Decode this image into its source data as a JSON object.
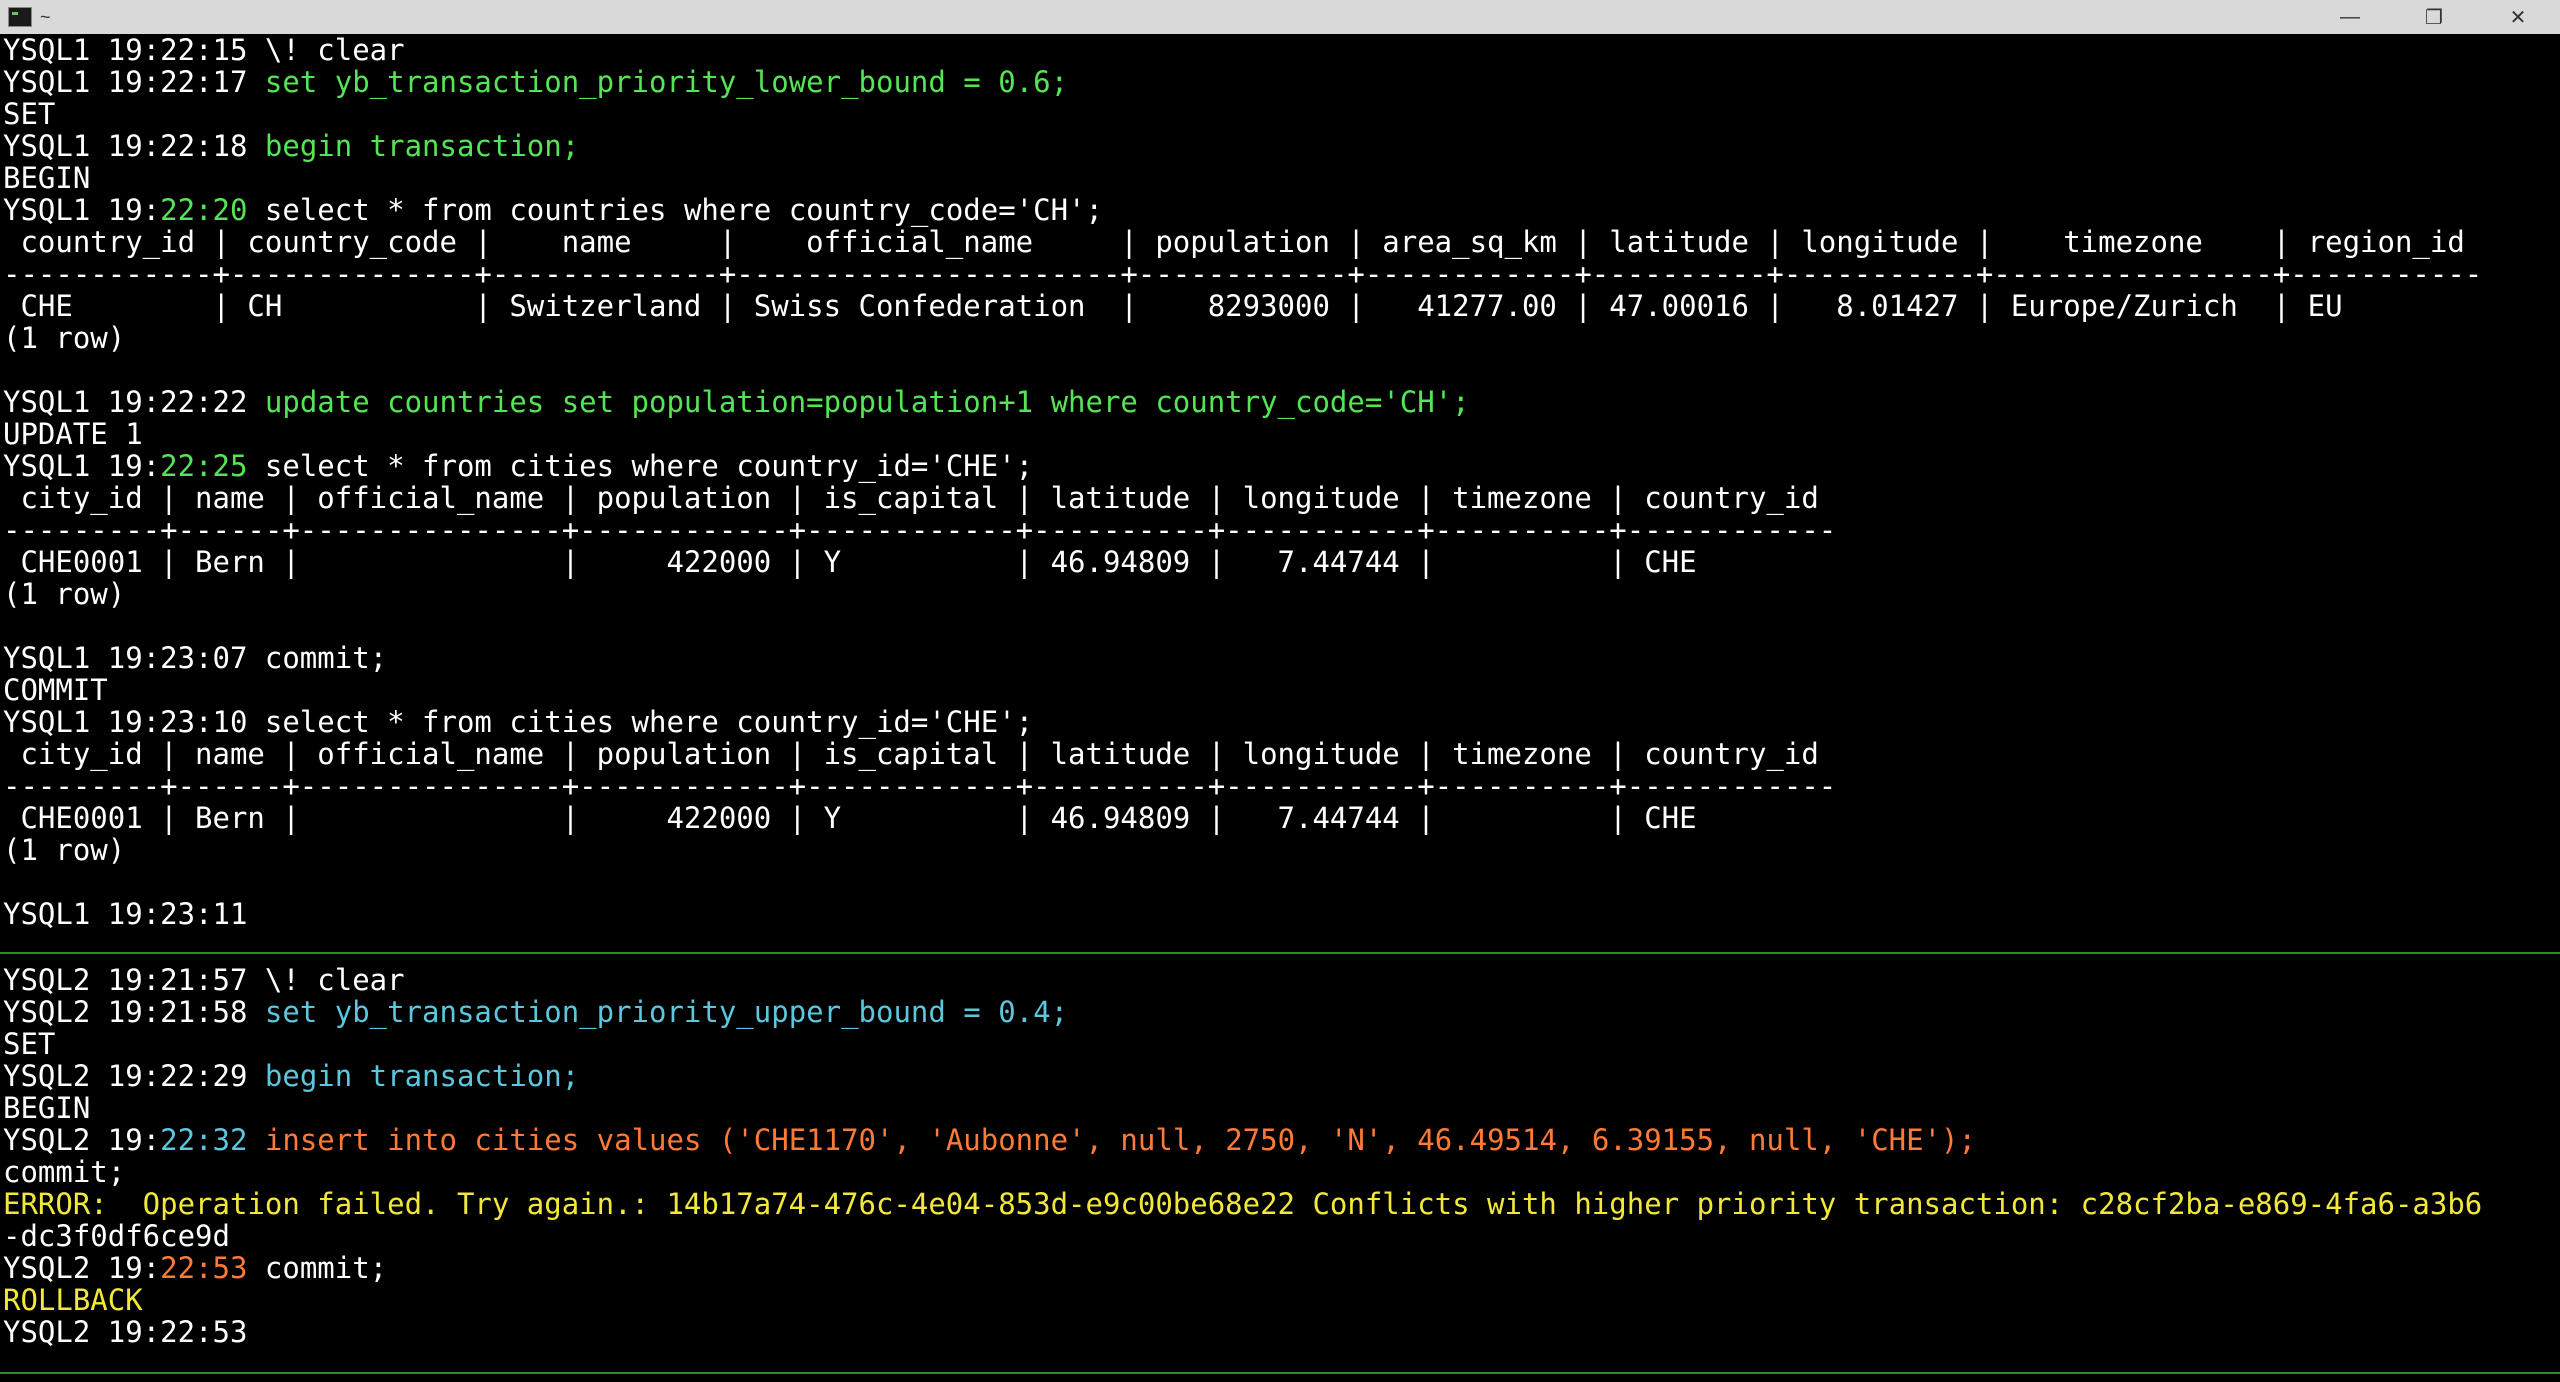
{
  "window": {
    "title": "~",
    "minimize_glyph": "—",
    "maximize_glyph": "❐",
    "close_glyph": "✕"
  },
  "pane1": {
    "l1": {
      "prompt": "YSQL1 19:22:15 ",
      "cmd": "\\! clear"
    },
    "l2": {
      "prompt": "YSQL1 19:22:17 ",
      "cmd": "set yb_transaction_priority_lower_bound = 0.6;"
    },
    "l3": "SET",
    "l4": {
      "prompt": "YSQL1 19:22:18 ",
      "cmd": "begin transaction;"
    },
    "l5": "BEGIN",
    "l6": {
      "p1": "YSQL1 19:",
      "p2": "22:20",
      "p3": " select * from countries where country_code='CH';"
    },
    "l7": " country_id | country_code |    name     |    official_name     | population | area_sq_km | latitude | longitude |    timezone    | region_id",
    "l8": "------------+--------------+-------------+----------------------+------------+------------+----------+-----------+----------------+-----------",
    "l9": " CHE        | CH           | Switzerland | Swiss Confederation  |    8293000 |   41277.00 | 47.00016 |   8.01427 | Europe/Zurich  | EU",
    "l10": "(1 row)",
    "l12": {
      "prompt": "YSQL1 19:22:22 ",
      "cmd": "update countries set population=population+1 where country_code='CH';"
    },
    "l13": "UPDATE 1",
    "l14": {
      "p1": "YSQL1 19:",
      "p2": "22:25",
      "p3": " select * from cities where country_id='CHE';"
    },
    "l15": " city_id | name | official_name | population | is_capital | latitude | longitude | timezone | country_id",
    "l16": "---------+------+---------------+------------+------------+----------+-----------+----------+------------",
    "l17": " CHE0001 | Bern |               |     422000 | Y          | 46.94809 |   7.44744 |          | CHE",
    "l18": "(1 row)",
    "l20": "YSQL1 19:23:07 commit;",
    "l21": "COMMIT",
    "l22": "YSQL1 19:23:10 select * from cities where country_id='CHE';",
    "l23": " city_id | name | official_name | population | is_capital | latitude | longitude | timezone | country_id",
    "l24": "---------+------+---------------+------------+------------+----------+-----------+----------+------------",
    "l25": " CHE0001 | Bern |               |     422000 | Y          | 46.94809 |   7.44744 |          | CHE",
    "l26": "(1 row)",
    "l28": "YSQL1 19:23:11"
  },
  "pane2": {
    "l1": {
      "prompt": "YSQL2 19:21:57 ",
      "cmd": "\\! clear"
    },
    "l2": {
      "prompt": "YSQL2 19:21:58 ",
      "cmd": "set yb_transaction_priority_upper_bound = 0.4;"
    },
    "l3": "SET",
    "l4": {
      "prompt": "YSQL2 19:22:29 ",
      "cmd": "begin transaction;"
    },
    "l5": "BEGIN",
    "l6": {
      "p1": "YSQL2 19:",
      "p2": "22:32",
      "p3": " ",
      "p4": "insert into cities values ('CHE1170', 'Aubonne', null, 2750, 'N', 46.49514, 6.39155, null, 'CHE');"
    },
    "l7": "commit;",
    "l8": "ERROR:  Operation failed. Try again.: 14b17a74-476c-4e04-853d-e9c00be68e22 Conflicts with higher priority transaction: c28cf2ba-e869-4fa6-a3b6",
    "l9": "-dc3f0df6ce9d",
    "l10": {
      "p1": "YSQL2 19:",
      "p2": "22:53",
      "p3": " commit;"
    },
    "l11": "ROLLBACK",
    "l12": "YSQL2 19:22:53"
  },
  "colors": {
    "background": "#000000",
    "text": "#ffffff",
    "sql_green": "#55e455",
    "sql_cyan": "#5bc6dd",
    "sql_orange": "#ff7a36",
    "error_yellow": "#f2e83c",
    "pane_separator": "#2e8b2e"
  }
}
